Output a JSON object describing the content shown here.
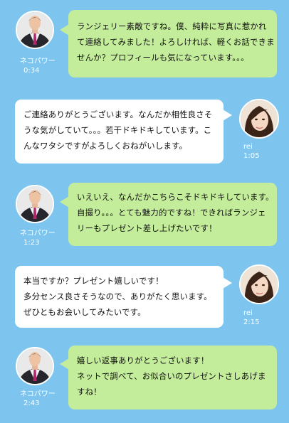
{
  "colors": {
    "background": "#7dc5ef",
    "green_bubble": "#c3ec9b",
    "white_bubble": "#ffffff",
    "meta_text": "#ffffff"
  },
  "messages": [
    {
      "sender": "ネコパワー",
      "time": "0:34",
      "side": "left",
      "avatar_icon": "man-in-suit-avatar-icon",
      "lines": [
        "ランジェリー素敵ですね。僕、純粋に写真に惹かれ",
        "て連絡してみました！よろしければ、軽くお話できま",
        "せんか？プロフィールも気になっています。。。"
      ]
    },
    {
      "sender": "rei",
      "time": "1:05",
      "side": "right",
      "avatar_icon": "woman-portrait-avatar-icon",
      "lines": [
        "ご連絡ありがとうございます。なんだか相性良さそ",
        "うな気がしていて。。。若干ドキドキしています。こ",
        "んなワタシですがよろしくおねがいします。"
      ]
    },
    {
      "sender": "ネコパワー",
      "time": "1:23",
      "side": "left",
      "avatar_icon": "man-in-suit-avatar-icon",
      "lines": [
        "いえいえ、なんだかこちらこそドキドキしています。",
        "自撮り。。。とても魅力的ですね！できればランジェ",
        "リーもプレゼント差し上げたいです！"
      ]
    },
    {
      "sender": "rei",
      "time": "2:15",
      "side": "right",
      "avatar_icon": "woman-portrait-avatar-icon",
      "lines": [
        "本当ですか？プレゼント嬉しいです！",
        "多分センス良さそうなので、ありがたく思います。",
        "ぜひともお会いしてみたいです。"
      ]
    },
    {
      "sender": "ネコパワー",
      "time": "2:43",
      "side": "left",
      "avatar_icon": "man-in-suit-avatar-icon",
      "lines": [
        "嬉しい返事ありがとうございます！",
        "ネットで調べて、お似合いのプレゼントさしあげま",
        "すね！"
      ]
    }
  ]
}
